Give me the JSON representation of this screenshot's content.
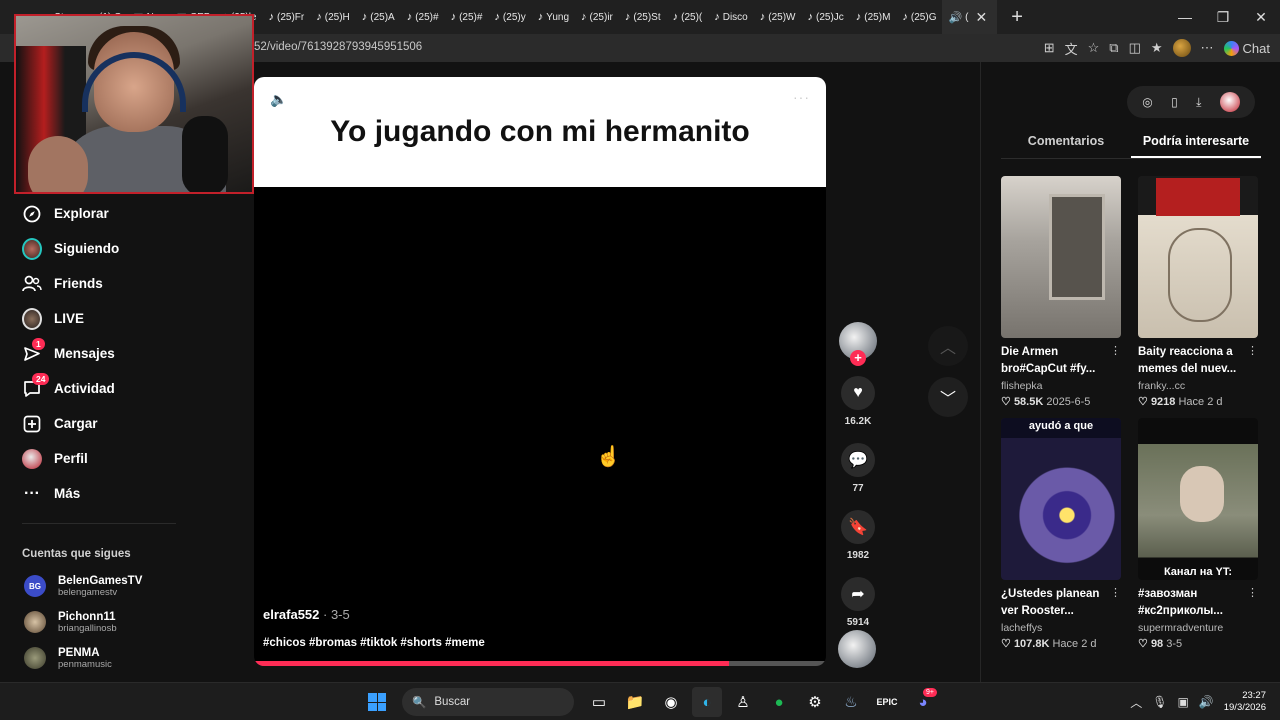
{
  "browser": {
    "tabs": [
      {
        "label": "Stea",
        "icon": "steam-icon"
      },
      {
        "label": "(1) C",
        "icon": "check-icon"
      },
      {
        "label": "Nav",
        "icon": "page-icon"
      },
      {
        "label": "CEB",
        "icon": "flag-icon"
      },
      {
        "label": "(25)le",
        "icon": "tiktok-icon"
      },
      {
        "label": "(25)Fr",
        "icon": "tiktok-icon"
      },
      {
        "label": "(25)H",
        "icon": "tiktok-icon"
      },
      {
        "label": "(25)A",
        "icon": "tiktok-icon"
      },
      {
        "label": "(25)#",
        "icon": "tiktok-icon"
      },
      {
        "label": "(25)#",
        "icon": "tiktok-icon"
      },
      {
        "label": "(25)y",
        "icon": "tiktok-icon"
      },
      {
        "label": "Yung",
        "icon": "tiktok-icon"
      },
      {
        "label": "(25)ir",
        "icon": "tiktok-icon"
      },
      {
        "label": "(25)St",
        "icon": "tiktok-icon"
      },
      {
        "label": "(25)(",
        "icon": "tiktok-icon"
      },
      {
        "label": "Disco",
        "icon": "tiktok-icon"
      },
      {
        "label": "(25)W",
        "icon": "tiktok-icon"
      },
      {
        "label": "(25)Jc",
        "icon": "tiktok-icon"
      },
      {
        "label": "(25)M",
        "icon": "tiktok-icon"
      },
      {
        "label": "(25)G",
        "icon": "tiktok-icon"
      }
    ],
    "active_tab_label": "(",
    "url": "52/video/7613928793945951506",
    "chat_label": "Chat"
  },
  "sidebar": {
    "items": [
      {
        "label": "Explorar",
        "icon": "compass-icon"
      },
      {
        "label": "Siguiendo",
        "icon": "following-avatar"
      },
      {
        "label": "Friends",
        "icon": "friends-icon"
      },
      {
        "label": "LIVE",
        "icon": "live-avatar"
      },
      {
        "label": "Mensajes",
        "icon": "messages-icon",
        "badge": "1"
      },
      {
        "label": "Actividad",
        "icon": "activity-icon",
        "badge": "24"
      },
      {
        "label": "Cargar",
        "icon": "upload-icon"
      },
      {
        "label": "Perfil",
        "icon": "profile-avatar"
      },
      {
        "label": "Más",
        "icon": "more-icon"
      }
    ],
    "following_title": "Cuentas que sigues",
    "following": [
      {
        "name": "BelenGamesTV",
        "handle": "belengamestv",
        "initials": "BG"
      },
      {
        "name": "Pichonn11",
        "handle": "briangallinosb",
        "initials": ""
      },
      {
        "name": "PENMA",
        "handle": "penmamusic",
        "initials": ""
      }
    ]
  },
  "video": {
    "caption": "Yo jugando con mi hermanito",
    "author": "elrafa552",
    "date": "3-5",
    "separator": " · ",
    "hashtags": "#chicos #bromas #tiktok #shorts #meme",
    "progress": 0.83
  },
  "actions": {
    "likes": "16.2K",
    "comments": "77",
    "saves": "1982",
    "shares": "5914"
  },
  "right_panel": {
    "tabs": [
      "Comentarios",
      "Podría interesarte"
    ],
    "active_tab": 1,
    "cards": [
      {
        "title": "Die Armen bro#CapCut #fy...",
        "author": "flishepka",
        "likes": "58.5K",
        "when": "2025-6-5",
        "overlay": "",
        "overlay_pos": "top"
      },
      {
        "title": "Baity reacciona a memes del nuev...",
        "author": "franky...cc",
        "likes": "9218",
        "when": "Hace 2 d",
        "overlay": "",
        "overlay_pos": "top"
      },
      {
        "title": "¿Ustedes planean ver Rooster...",
        "author": "lacheffys",
        "likes": "107.8K",
        "when": "Hace 2 d",
        "overlay": "ayudó a que",
        "overlay_pos": "top"
      },
      {
        "title": "#завозман #кс2приколы...",
        "author": "supermradventure",
        "likes": "98",
        "when": "3-5",
        "overlay": "Канал на YT:",
        "overlay_pos": "bottom"
      }
    ]
  },
  "taskbar": {
    "search_placeholder": "Buscar",
    "time": "23:27",
    "date": "19/3/2026",
    "discord_badge": "9+"
  }
}
